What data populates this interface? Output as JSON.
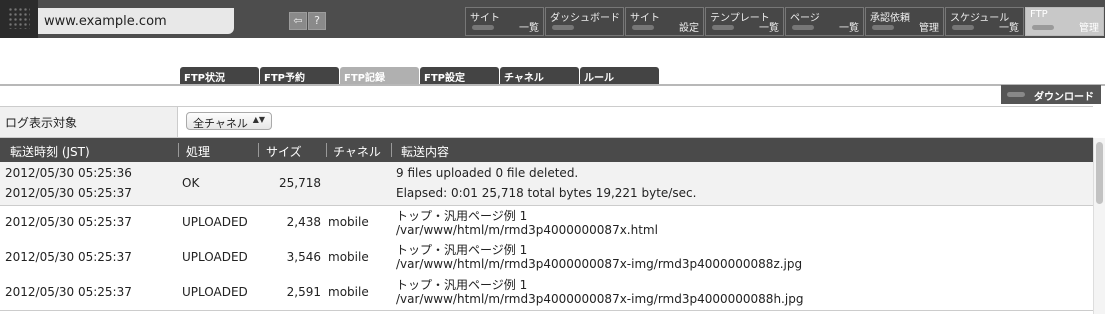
{
  "header": {
    "url": "www.example.com",
    "icons": [
      "back-icon",
      "help-icon"
    ],
    "help_glyph": "?",
    "nav": [
      {
        "top": "サイト",
        "bottom": "一覧"
      },
      {
        "top": "ダッシュボード",
        "bottom": ""
      },
      {
        "top": "サイト",
        "bottom": "設定"
      },
      {
        "top": "テンプレート",
        "bottom": "一覧"
      },
      {
        "top": "ページ",
        "bottom": "一覧"
      },
      {
        "top": "承認依頼",
        "bottom": "管理"
      },
      {
        "top": "スケジュール",
        "bottom": "一覧"
      },
      {
        "top": "FTP",
        "bottom": "管理",
        "active": true
      }
    ]
  },
  "tabs": [
    "FTP状況",
    "FTP予約",
    "FTP記録",
    "FTP設定",
    "チャネル",
    "ルール"
  ],
  "active_tab": "FTP記録",
  "download_label": "ダウンロード",
  "filter": {
    "label": "ログ表示対象",
    "selected": "全チャネル",
    "arrow": "▲▼"
  },
  "table": {
    "headers": [
      "転送時刻 (JST)",
      "処理",
      "サイズ",
      "チャネル",
      "転送内容"
    ],
    "rows": [
      {
        "times": [
          "2012/05/30 05:25:36",
          "2012/05/30 05:25:37"
        ],
        "action": "OK",
        "size": "25,718",
        "channel": "",
        "lines": [
          "9 files uploaded   0 file deleted.",
          "Elapsed: 0:01   25,718 total bytes   19,221 byte/sec."
        ]
      },
      {
        "times": [
          "2012/05/30 05:25:37"
        ],
        "action": "UPLOADED",
        "size": "2,438",
        "channel": "mobile",
        "lines": [
          "トップ・汎用ページ例 1",
          "/var/www/html/m/rmd3p4000000087x.html"
        ]
      },
      {
        "times": [
          "2012/05/30 05:25:37"
        ],
        "action": "UPLOADED",
        "size": "3,546",
        "channel": "mobile",
        "lines": [
          "トップ・汎用ページ例 1",
          "/var/www/html/m/rmd3p4000000087x-img/rmd3p4000000088z.jpg"
        ]
      },
      {
        "times": [
          "2012/05/30 05:25:37"
        ],
        "action": "UPLOADED",
        "size": "2,591",
        "channel": "mobile",
        "lines": [
          "トップ・汎用ページ例 1",
          "/var/www/html/m/rmd3p4000000087x-img/rmd3p4000000088h.jpg"
        ]
      }
    ]
  }
}
